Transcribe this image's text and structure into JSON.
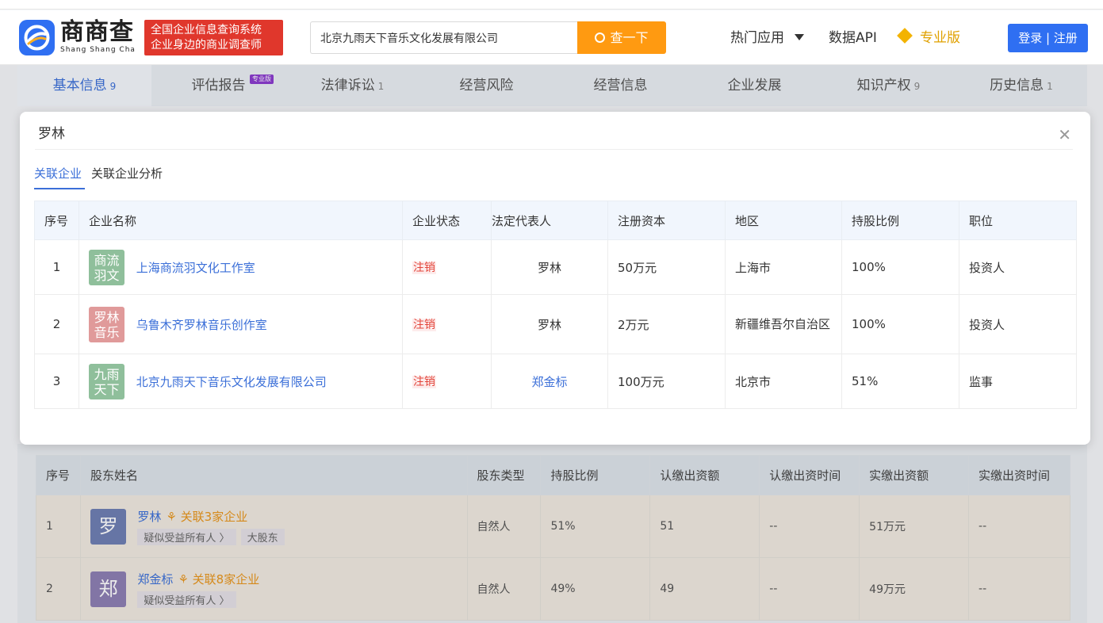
{
  "header": {
    "logo_cn": "商商查",
    "logo_en": "Shang Shang Cha",
    "slogan_line1": "全国企业信息查询系统",
    "slogan_line2": "企业身边的商业调查师",
    "search_value": "北京九雨天下音乐文化发展有限公司",
    "search_button": "查一下",
    "nav_hot": "热门应用",
    "nav_api": "数据API",
    "nav_pro": "专业版",
    "login": "登录 | 注册"
  },
  "bg_tabs": [
    {
      "label": "基本信息",
      "count": "9"
    },
    {
      "label": "评估报告",
      "count": "",
      "tag": "专业版"
    },
    {
      "label": "法律诉讼",
      "count": "1"
    },
    {
      "label": "经营风险",
      "count": ""
    },
    {
      "label": "经营信息",
      "count": ""
    },
    {
      "label": "企业发展",
      "count": ""
    },
    {
      "label": "知识产权",
      "count": "9"
    },
    {
      "label": "历史信息",
      "count": "1"
    }
  ],
  "modal": {
    "title": "罗林",
    "tabs": [
      "关联企业",
      "关联企业分析"
    ],
    "columns": [
      "序号",
      "企业名称",
      "企业状态",
      "法定代表人",
      "注册资本",
      "地区",
      "持股比例",
      "职位"
    ],
    "rows": [
      {
        "idx": "1",
        "logo_line1": "商流",
        "logo_line2": "羽文",
        "logo_color": "#8fbf9b",
        "name": "上海商流羽文化工作室",
        "status": "注销",
        "legal_rep": "罗林",
        "capital": "50万元",
        "region": "上海市",
        "ratio": "100%",
        "position": "投资人"
      },
      {
        "idx": "2",
        "logo_line1": "罗林",
        "logo_line2": "音乐",
        "logo_color": "#e09a9a",
        "name": "乌鲁木齐罗林音乐创作室",
        "status": "注销",
        "legal_rep": "罗林",
        "capital": "2万元",
        "region": "新疆维吾尔自治区",
        "ratio": "100%",
        "position": "投资人"
      },
      {
        "idx": "3",
        "logo_line1": "九雨",
        "logo_line2": "天下",
        "logo_color": "#8fbf9b",
        "name": "北京九雨天下音乐文化发展有限公司",
        "status": "注销",
        "legal_rep": "郑金标",
        "capital": "100万元",
        "region": "北京市",
        "ratio": "51%",
        "position": "监事"
      }
    ]
  },
  "shareholders": {
    "columns": [
      "序号",
      "股东姓名",
      "股东类型",
      "持股比例",
      "认缴出资额",
      "认缴出资时间",
      "实缴出资额",
      "实缴出资时间"
    ],
    "rows": [
      {
        "idx": "1",
        "avatar": "罗",
        "avatar_color": "#6f7fb3",
        "name": "罗林",
        "assoc": "关联3家企业",
        "tags": [
          "疑似受益所有人 〉",
          "大股东"
        ],
        "type": "自然人",
        "ratio": "51%",
        "sub_amount": "51",
        "sub_time": "--",
        "paid_amount": "51万元",
        "paid_time": "--"
      },
      {
        "idx": "2",
        "avatar": "郑",
        "avatar_color": "#8e7fb4",
        "name": "郑金标",
        "assoc": "关联8家企业",
        "tags": [
          "疑似受益所有人 〉"
        ],
        "type": "自然人",
        "ratio": "49%",
        "sub_amount": "49",
        "sub_time": "--",
        "paid_amount": "49万元",
        "paid_time": "--"
      }
    ]
  }
}
